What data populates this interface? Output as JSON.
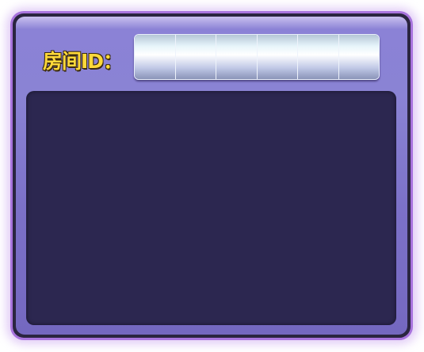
{
  "room_id": {
    "label": "房间ID：",
    "digits": [
      "",
      "",
      "",
      "",
      "",
      ""
    ]
  },
  "colors": {
    "label": "#ffd93a",
    "panel": "#8a83d4",
    "content": "#2c2750"
  }
}
